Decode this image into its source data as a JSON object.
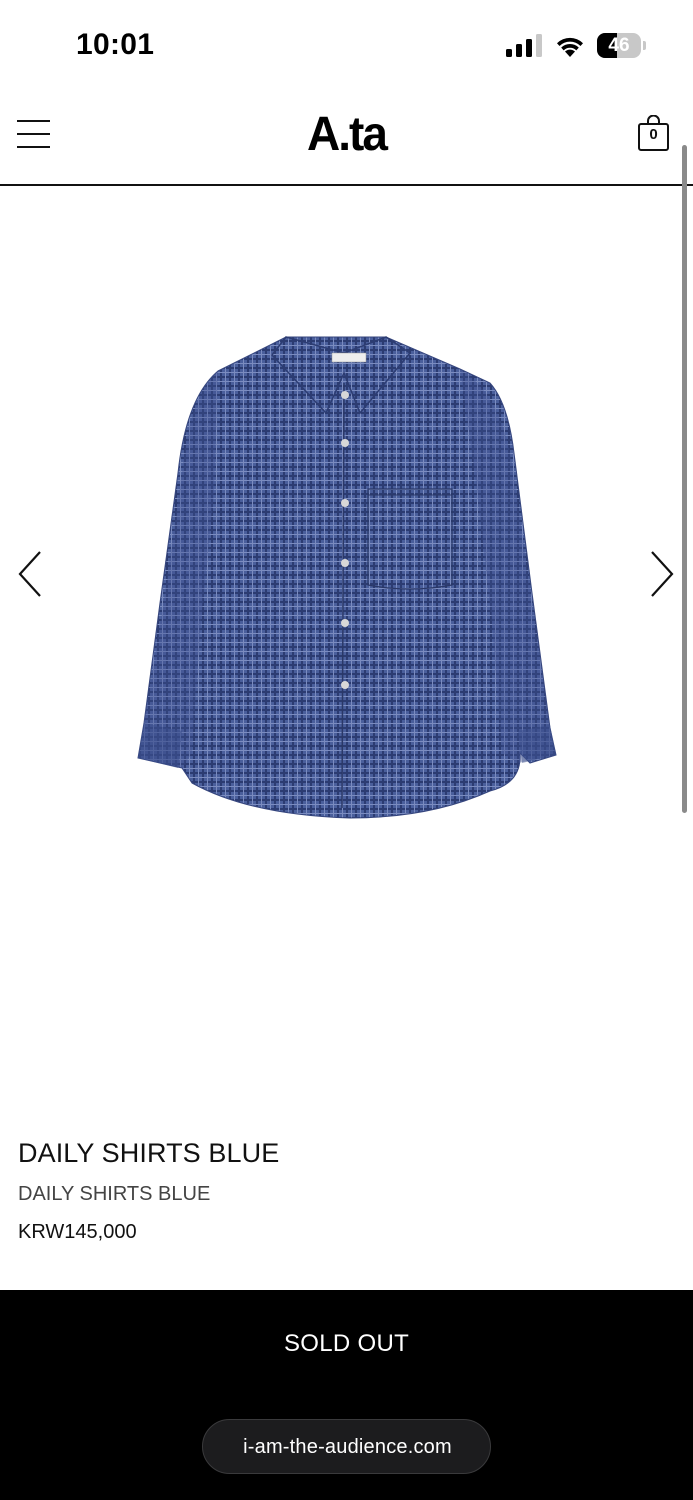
{
  "status_bar": {
    "time": "10:01",
    "battery_percent": "46",
    "battery_level": 0.46,
    "signal_bars_active": 3,
    "signal_bars_total": 4
  },
  "header": {
    "logo": "A.ta",
    "cart_count": "0",
    "menu_icon": "hamburger-menu-icon",
    "cart_icon": "shopping-bag-icon"
  },
  "gallery": {
    "image_alt": "blue checked long-sleeve shirt",
    "image_color": "#4a5f9c",
    "prev_icon": "chevron-left-icon",
    "next_icon": "chevron-right-icon"
  },
  "product": {
    "title": "DAILY SHIRTS BLUE",
    "subtitle": "DAILY SHIRTS BLUE",
    "price": "KRW145,000"
  },
  "actions": {
    "sold_out_label": "SOLD OUT"
  },
  "browser": {
    "url": "i-am-the-audience.com"
  },
  "colors": {
    "bottom_bar": "#000000",
    "accent": "#111111"
  }
}
